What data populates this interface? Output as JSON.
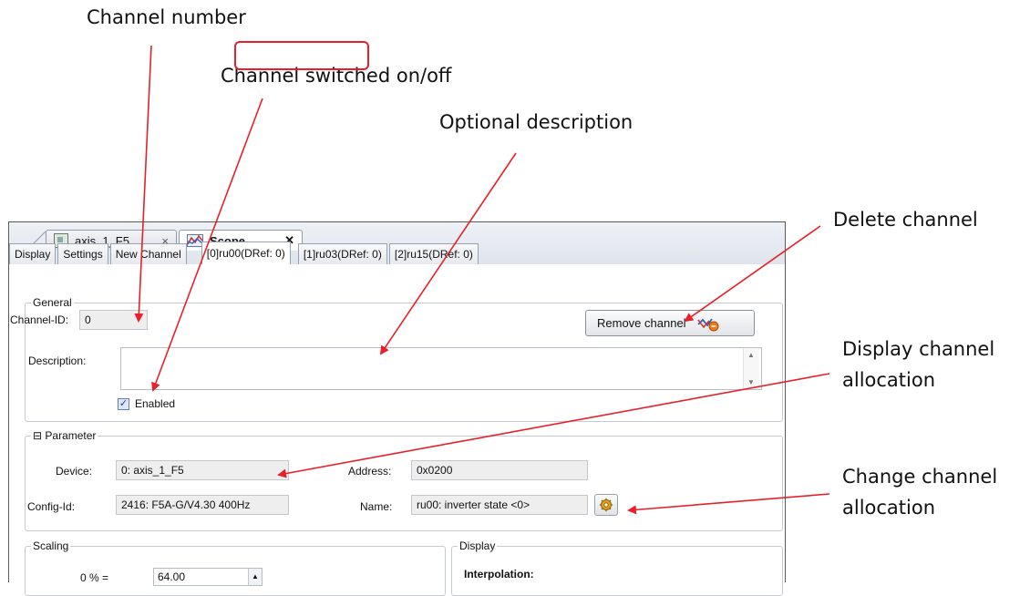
{
  "callouts": {
    "channel_number": "Channel number",
    "channel_switched": "Channel switched on/off",
    "optional_description": "Optional description",
    "delete_channel": "Delete channel",
    "display_allocation_1": "Display channel",
    "display_allocation_2": "allocation",
    "change_allocation_1": "Change channel",
    "change_allocation_2": "allocation"
  },
  "editor_tabs": [
    {
      "label": "axis_1_F5",
      "close": "×"
    },
    {
      "label": "Scope",
      "close": "✕"
    }
  ],
  "subtabs": [
    "Display",
    "Settings",
    "New Channel",
    "[0]ru00(DRef: 0)",
    "[1]ru03(DRef: 0)",
    "[2]ru15(DRef: 0)"
  ],
  "general": {
    "legend": "General",
    "channel_id_label": "Channel-ID:",
    "channel_id_value": "0",
    "remove_button": "Remove channel",
    "description_label": "Description:",
    "description_value": "",
    "enabled_label": "Enabled",
    "enabled_checked": true
  },
  "parameter": {
    "legend": "Parameter",
    "collapse_glyph": "⊟",
    "device_label": "Device:",
    "device_value": "0: axis_1_F5",
    "address_label": "Address:",
    "address_value": "0x0200",
    "config_label": "Config-Id:",
    "config_value": "2416: F5A-G/V4.30 400Hz",
    "name_label": "Name:",
    "name_value": "ru00: inverter state <0>"
  },
  "scaling": {
    "legend": "Scaling",
    "zero_label": "0 % =",
    "zero_value": "64.00"
  },
  "display": {
    "legend": "Display",
    "interpolation_label": "Interpolation:"
  },
  "colors": {
    "arrow": "#e8202a",
    "highlight": "#e8202a"
  }
}
